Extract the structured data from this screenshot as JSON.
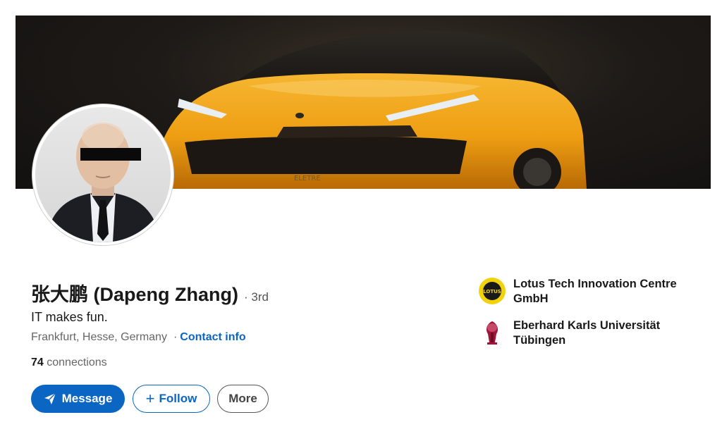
{
  "profile": {
    "name": "张大鹏 (Dapeng Zhang)",
    "degree": "· 3rd",
    "headline": "IT makes fun.",
    "location": "Frankfurt, Hesse, Germany",
    "contact_prefix": "·",
    "contact_label": "Contact info",
    "connections_count": "74",
    "connections_label": "connections"
  },
  "actions": {
    "message_label": "Message",
    "follow_label": "Follow",
    "more_label": "More"
  },
  "banner": {
    "car_plate_text": "ELETRE"
  },
  "organizations": [
    {
      "name": "Lotus Tech Innovation Centre GmbH",
      "logo_text": "LOTUS",
      "icon": "lotus-logo-icon"
    },
    {
      "name": "Eberhard Karls Universität Tübingen",
      "icon": "university-crest-icon"
    }
  ],
  "colors": {
    "accent": "#0a66c2",
    "car_body": "#f0a820",
    "lotus_yellow": "#f2d20a"
  }
}
